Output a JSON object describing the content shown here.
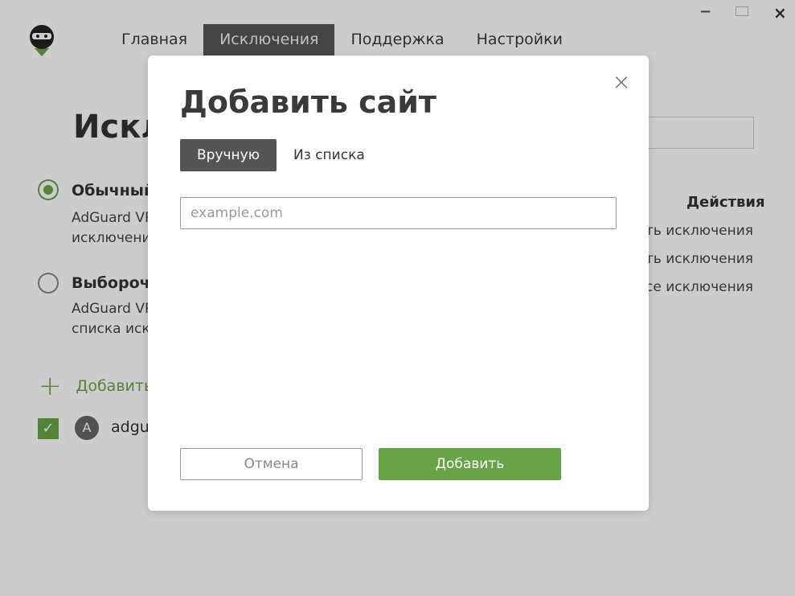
{
  "window": {
    "minimize": "−",
    "close": "×"
  },
  "nav": {
    "items": [
      {
        "label": "Главная"
      },
      {
        "label": "Исключения"
      },
      {
        "label": "Поддержка"
      },
      {
        "label": "Настройки"
      }
    ],
    "active_index": 1
  },
  "page": {
    "title": "Искл",
    "options": [
      {
        "title": "Обычный",
        "desc_line1": "AdGuard VP",
        "desc_line2": "исключений"
      },
      {
        "title": "Выборочн",
        "desc_line1": "AdGuard VP",
        "desc_line2": "списка искл"
      }
    ],
    "add_label": "Добавить",
    "site": {
      "avatar_letter": "A",
      "name": "adgu"
    },
    "actions": {
      "heading": "Действия",
      "items": [
        "ать исключения",
        "ать исключения",
        "все исключения"
      ]
    }
  },
  "modal": {
    "title": "Добавить сайт",
    "close": "×",
    "tabs": [
      "Вручную",
      "Из списка"
    ],
    "active_tab": 0,
    "input": {
      "value": "",
      "placeholder": "example.com"
    },
    "cancel_label": "Отмена",
    "add_label": "Добавить"
  },
  "colors": {
    "accent": "#68a347",
    "dark": "#555555"
  }
}
